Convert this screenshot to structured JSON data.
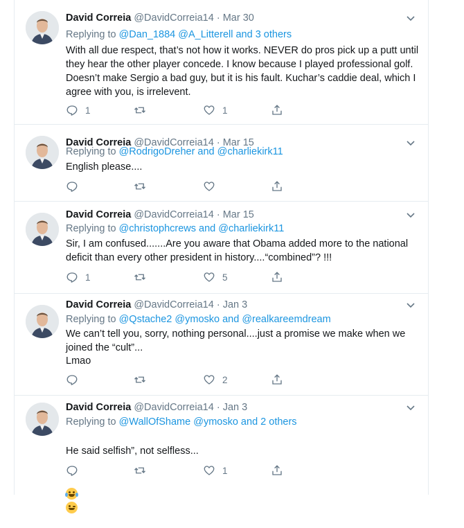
{
  "accent_color": "#1b95e0",
  "tweets": [
    {
      "name": "David Correia",
      "handle": "@DavidCorreia14",
      "date": "Mar 30",
      "replying_prefix": "Replying to ",
      "replying_links": "@Dan_1884 @A_Litterell and 3 others",
      "text": "With all due respect, that’s not how it works. NEVER do pros pick up a putt until they hear the other player concede. I know because I played professional golf. Doesn’t make Sergio a bad guy, but it is his fault. Kuchar’s caddie deal, which I agree with you, is irrelevent.",
      "replies": "1",
      "retweets": "",
      "likes": "1"
    },
    {
      "name": "David Correia",
      "handle": "@DavidCorreia14",
      "date": "Mar 15",
      "replying_prefix": "Replying to ",
      "replying_links": "@RodrigoDreher and @charliekirk11",
      "text": "English please....",
      "replies": "",
      "retweets": "",
      "likes": ""
    },
    {
      "name": "David Correia",
      "handle": "@DavidCorreia14",
      "date": "Mar 15",
      "replying_prefix": "Replying to ",
      "replying_links": "@christophcrews and @charliekirk11",
      "text": "Sir, I am confused.......Are you aware that Obama added more to the national deficit than every other president in history....“combined”? !!!",
      "replies": "1",
      "retweets": "",
      "likes": "5"
    },
    {
      "name": "David Correia",
      "handle": "@DavidCorreia14",
      "date": "Jan 3",
      "replying_prefix": "Replying to ",
      "replying_links": "@Qstache2 @ymosko and @realkareemdream",
      "text": "We can’t tell you, sorry, nothing personal....just a promise we make when we joined the “cult”...\nLmao",
      "replies": "",
      "retweets": "",
      "likes": "2"
    },
    {
      "name": "David Correia",
      "handle": "@DavidCorreia14",
      "date": "Jan 3",
      "replying_prefix": "Replying to ",
      "replying_links": "@WallOfShame @ymosko and 2 others",
      "text": "He said selfish”, not selfless...",
      "emojis": [
        "face-with-tears-of-joy",
        "winking-face"
      ],
      "replies": "",
      "retweets": "",
      "likes": "1"
    }
  ]
}
